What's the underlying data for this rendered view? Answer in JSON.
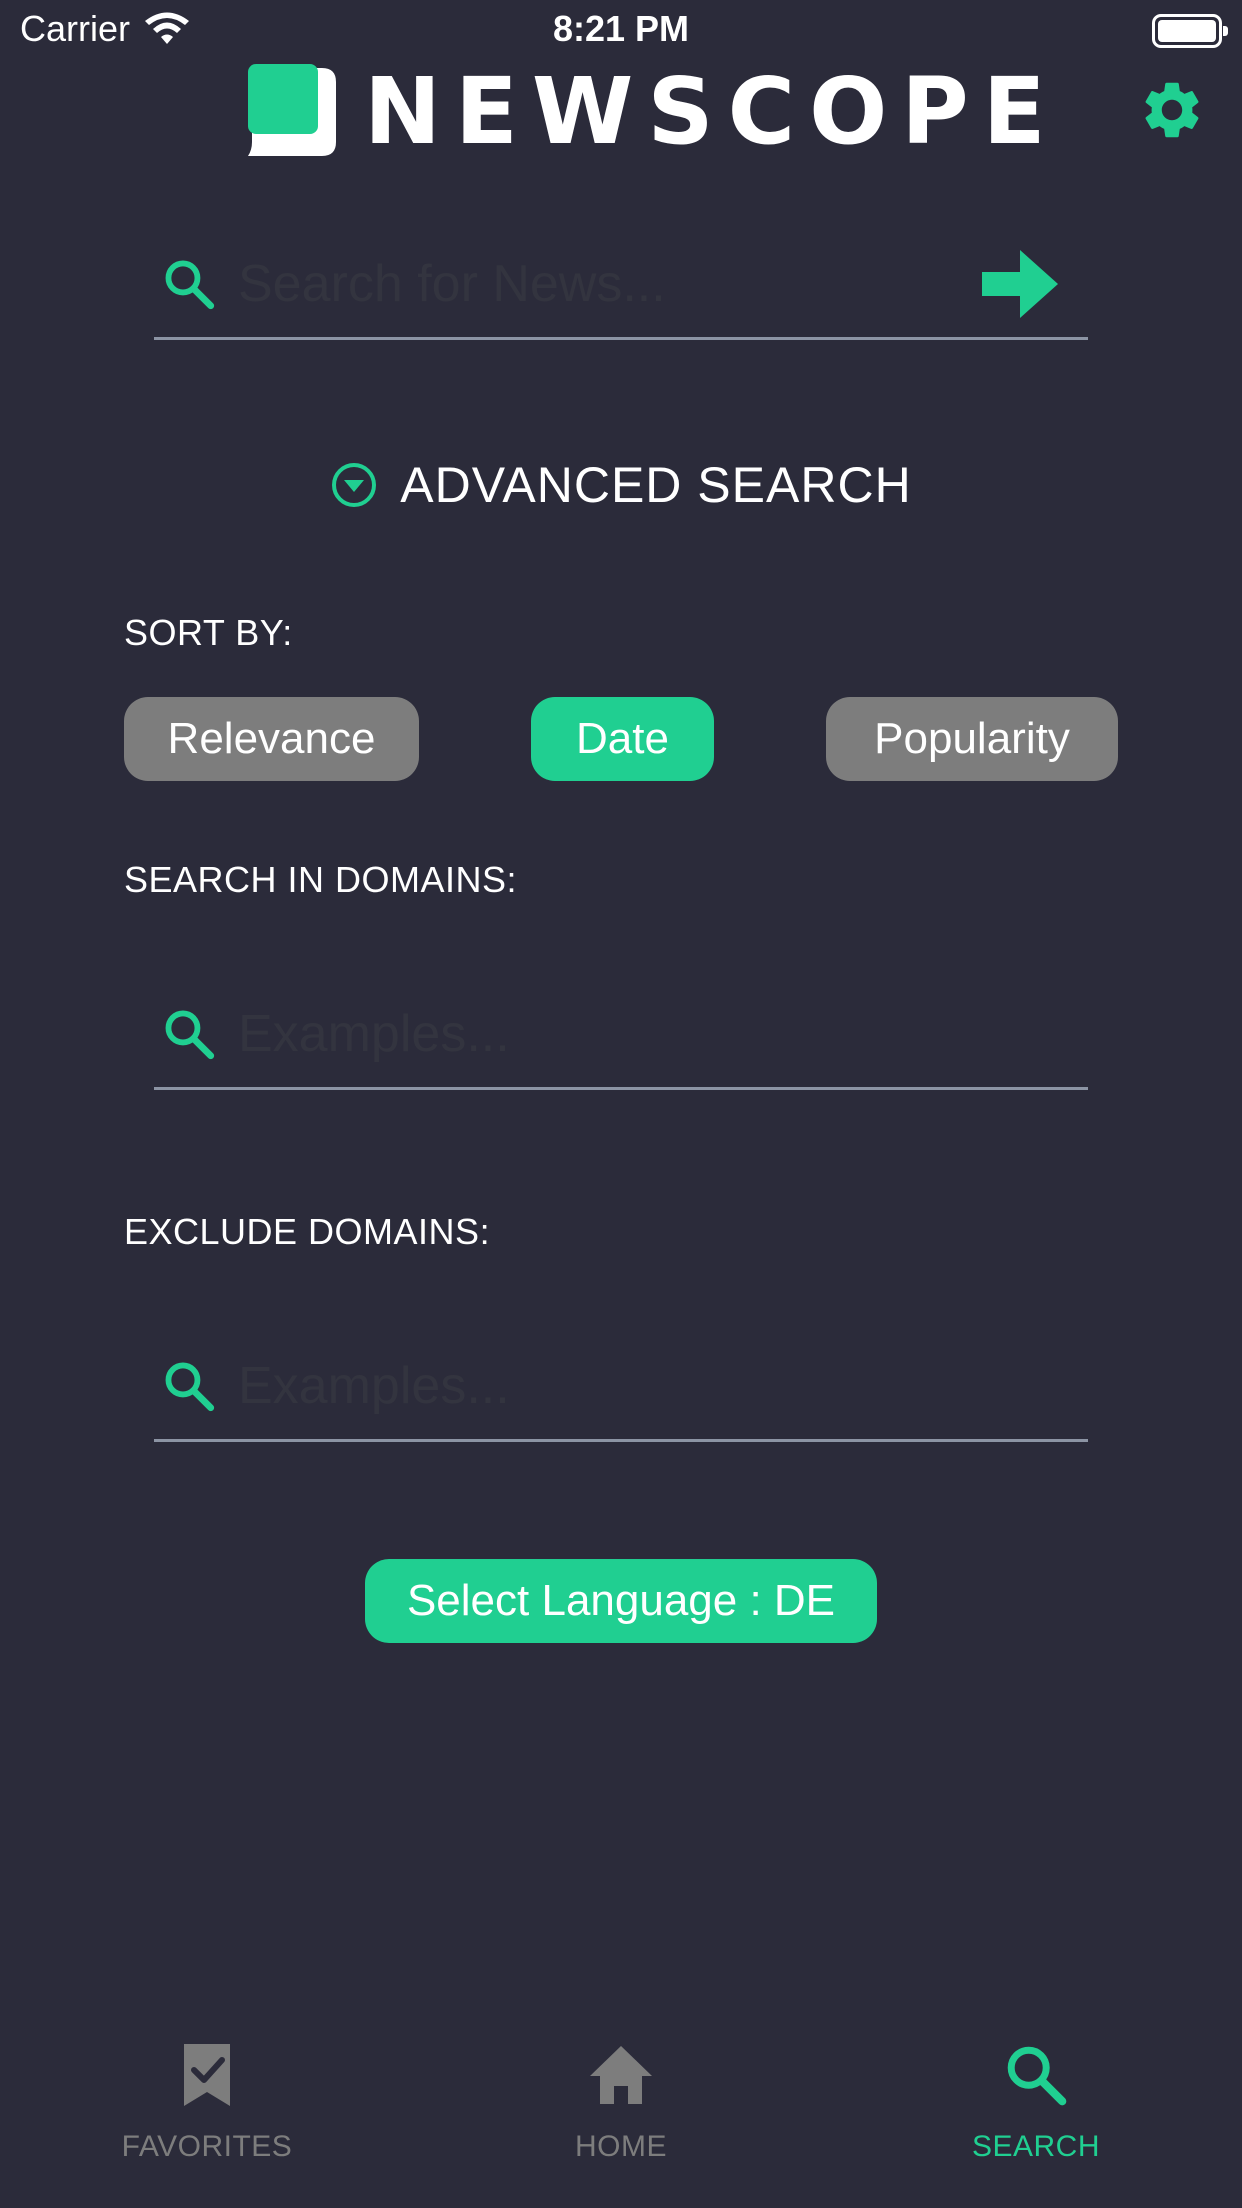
{
  "status": {
    "carrier": "Carrier",
    "time": "8:21 PM"
  },
  "header": {
    "logo_text": "NEWSCOPE",
    "settings_icon": "gear-icon"
  },
  "search": {
    "placeholder": "Search for News...",
    "value": ""
  },
  "advanced": {
    "title": "ADVANCED SEARCH"
  },
  "sort": {
    "label": "SORT BY:",
    "options": [
      "Relevance",
      "Date",
      "Popularity"
    ],
    "selected": "Date"
  },
  "domains": {
    "label": "SEARCH IN DOMAINS:",
    "placeholder": "Examples..."
  },
  "exclude": {
    "label": "EXCLUDE DOMAINS:",
    "placeholder": "Examples..."
  },
  "language": {
    "button": "Select Language : DE"
  },
  "tabbar": {
    "items": [
      {
        "label": "FAVORITES",
        "icon": "bookmark-check-icon"
      },
      {
        "label": "HOME",
        "icon": "home-icon"
      },
      {
        "label": "SEARCH",
        "icon": "search-icon"
      }
    ],
    "active": "SEARCH"
  },
  "colors": {
    "background": "#2b2b3a",
    "accent": "#20cf91",
    "inactive": "#7d7d7d",
    "underline": "#8c94a4"
  }
}
